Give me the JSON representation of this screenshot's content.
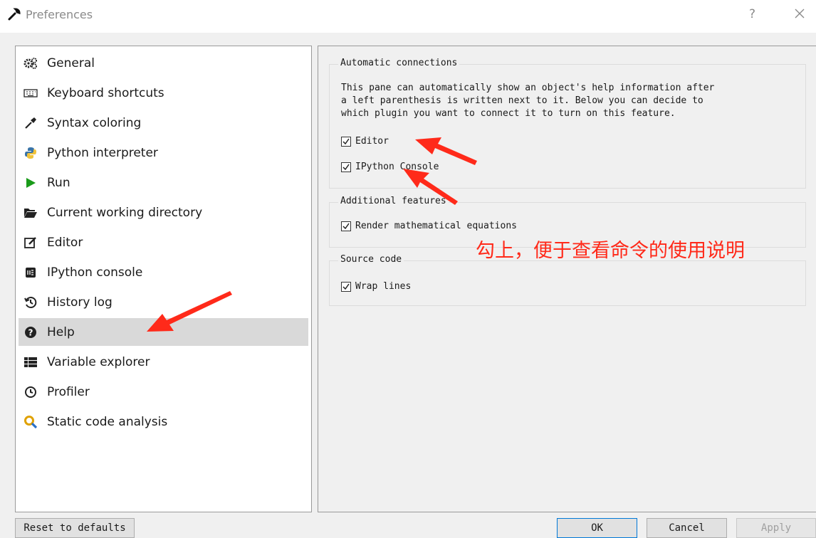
{
  "window": {
    "title": "Preferences",
    "help_label": "?",
    "close_label": "×"
  },
  "sidebar": {
    "selected_index": 9,
    "items": [
      {
        "label": "General",
        "icon": "gears-icon"
      },
      {
        "label": "Keyboard shortcuts",
        "icon": "keyboard-icon"
      },
      {
        "label": "Syntax coloring",
        "icon": "eyedropper-icon"
      },
      {
        "label": "Python interpreter",
        "icon": "python-icon"
      },
      {
        "label": "Run",
        "icon": "play-icon"
      },
      {
        "label": "Current working directory",
        "icon": "folder-open-icon"
      },
      {
        "label": "Editor",
        "icon": "edit-icon"
      },
      {
        "label": "IPython console",
        "icon": "terminal-icon"
      },
      {
        "label": "History log",
        "icon": "history-icon"
      },
      {
        "label": "Help",
        "icon": "question-circle-icon"
      },
      {
        "label": "Variable explorer",
        "icon": "table-list-icon"
      },
      {
        "label": "Profiler",
        "icon": "clock-icon"
      },
      {
        "label": "Static code analysis",
        "icon": "magnifier-icon"
      }
    ]
  },
  "content": {
    "automatic_connections": {
      "title": "Automatic connections",
      "description": "This pane can automatically show an object's help information after\na left parenthesis is written next to it. Below you can decide to\nwhich plugin you want to connect it to turn on this feature.",
      "editor": {
        "label": "Editor",
        "checked": true
      },
      "ipython_console": {
        "label": "IPython Console",
        "checked": true
      }
    },
    "additional_features": {
      "title": "Additional features",
      "render_math": {
        "label": "Render mathematical equations",
        "checked": true
      }
    },
    "source_code": {
      "title": "Source code",
      "wrap_lines": {
        "label": "Wrap lines",
        "checked": true
      }
    }
  },
  "annotation": {
    "text": "勾上，便于查看命令的使用说明",
    "color": "#ff2a1a"
  },
  "buttons": {
    "reset": "Reset to defaults",
    "ok": "OK",
    "cancel": "Cancel",
    "apply": "Apply"
  }
}
